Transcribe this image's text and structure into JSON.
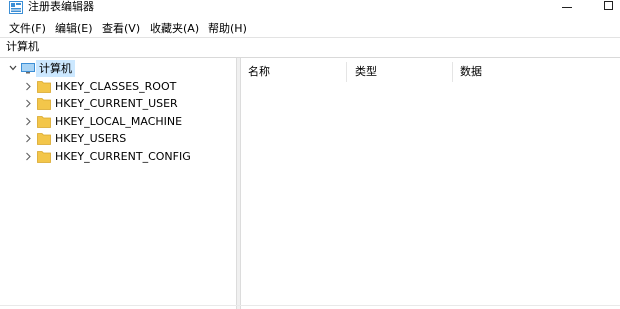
{
  "window": {
    "title": "注册表编辑器"
  },
  "menu": [
    "文件(F)",
    "编辑(E)",
    "查看(V)",
    "收藏夹(A)",
    "帮助(H)"
  ],
  "address": {
    "path": "计算机"
  },
  "tree": {
    "root": {
      "label": "计算机",
      "expanded": true
    },
    "children": [
      {
        "label": "HKEY_CLASSES_ROOT"
      },
      {
        "label": "HKEY_CURRENT_USER"
      },
      {
        "label": "HKEY_LOCAL_MACHINE"
      },
      {
        "label": "HKEY_USERS"
      },
      {
        "label": "HKEY_CURRENT_CONFIG"
      }
    ]
  },
  "list": {
    "columns": [
      "名称",
      "类型",
      "数据"
    ]
  },
  "colors": {
    "folder": "#f3c64a",
    "selection": "#cce8ff",
    "monitor": "#3c8fd6"
  },
  "icons": {
    "app": "regedit-icon",
    "root": "computer-icon",
    "child": "folder-icon",
    "expander": "chevron-right-icon"
  }
}
